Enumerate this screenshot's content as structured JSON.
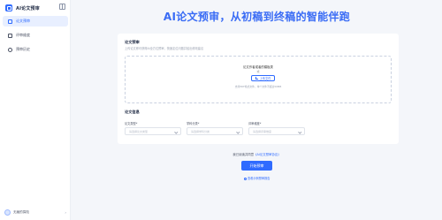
{
  "sidebar": {
    "logo_text": "AI论文预审",
    "items": [
      {
        "label": "论文预审",
        "active": true
      },
      {
        "label": "评审维度"
      },
      {
        "label": "预审历史"
      }
    ],
    "user": {
      "name": "无痕的探险"
    }
  },
  "main": {
    "hero": "AI论文预审，从初稿到终稿的智能伴跑",
    "upload_section": {
      "title": "论文预审",
      "subtitle": "上传论文即可获得AI全方位预审，快速定位问题并给出修改建议",
      "drop_title": "论文作者或者的模板类",
      "or": "或",
      "button": "上传文件",
      "hint": "支持PDF格式文件，单个文件不超过50MB"
    },
    "info_section": {
      "title": "论文信息",
      "fields": [
        {
          "label": "论文类型*",
          "placeholder": "请选择论文类型"
        },
        {
          "label": "学科分类*",
          "placeholder": "请选择学科分类"
        },
        {
          "label": "评审维度*",
          "placeholder": "请选择评审维度"
        }
      ]
    },
    "agreement_text": "我已阅读并同意",
    "agreement_link": "《AI论文预审协议》",
    "primary_button": "开始预审",
    "example_link": "查看示例预审报告"
  }
}
